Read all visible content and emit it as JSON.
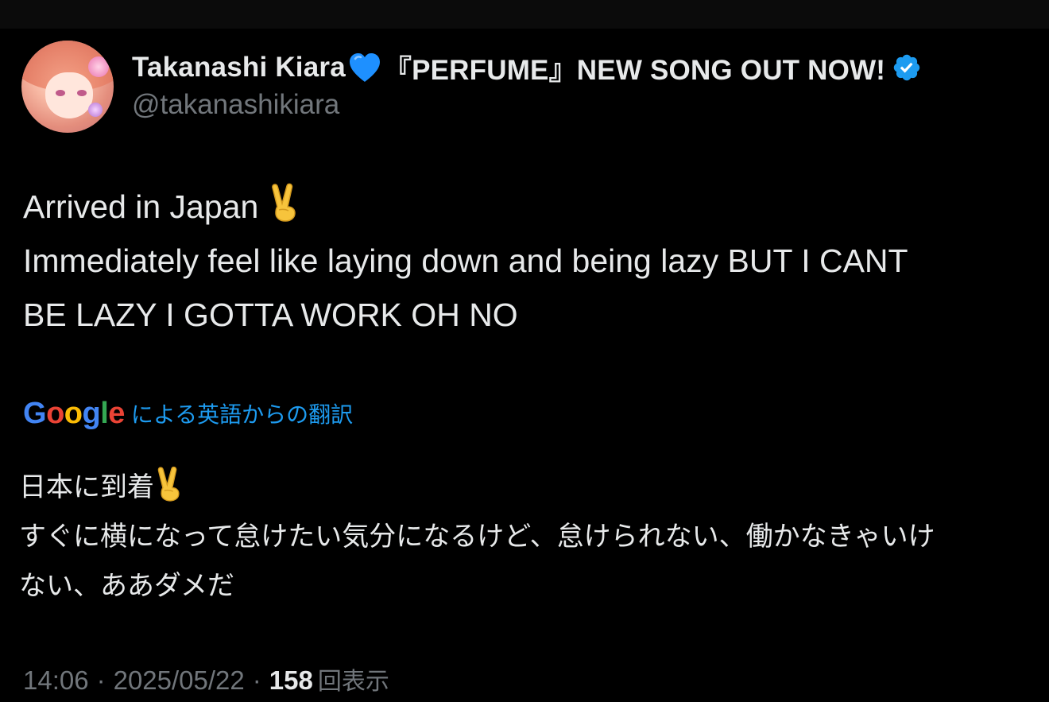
{
  "colors": {
    "background": "#000000",
    "primary_text": "#e7e9ea",
    "secondary_text": "#71767b",
    "link_blue": "#1d9bf0",
    "verified_blue": "#1d9bf0",
    "heart_blue": "#1e90ff"
  },
  "author": {
    "display_name": "Takanashi Kiara",
    "name_suffix": "『PERFUME』NEW SONG OUT NOW!",
    "handle": "@takanashikiara",
    "heart_icon": "blue-heart-emoji",
    "verified_icon": "verified-badge-icon",
    "avatar": "avatar-image"
  },
  "tweet": {
    "line1": "Arrived in Japan ",
    "line1_emoji": "victory-hand-emoji",
    "line2": "Immediately feel like laying down and being lazy BUT I CANT",
    "line3": "BE LAZY I GOTTA WORK OH NO"
  },
  "translation": {
    "google_logo": "Google",
    "label": "による英語からの翻訳",
    "line1": "日本に到着",
    "line1_emoji": "victory-hand-emoji",
    "line2": "すぐに横になって怠けたい気分になるけど、怠けられない、働かなきゃいけ",
    "line3": "ない、ああダメだ"
  },
  "meta": {
    "time": "14:06",
    "separator": "·",
    "date": "2025/05/22",
    "view_count": "158",
    "views_label": "回表示"
  }
}
